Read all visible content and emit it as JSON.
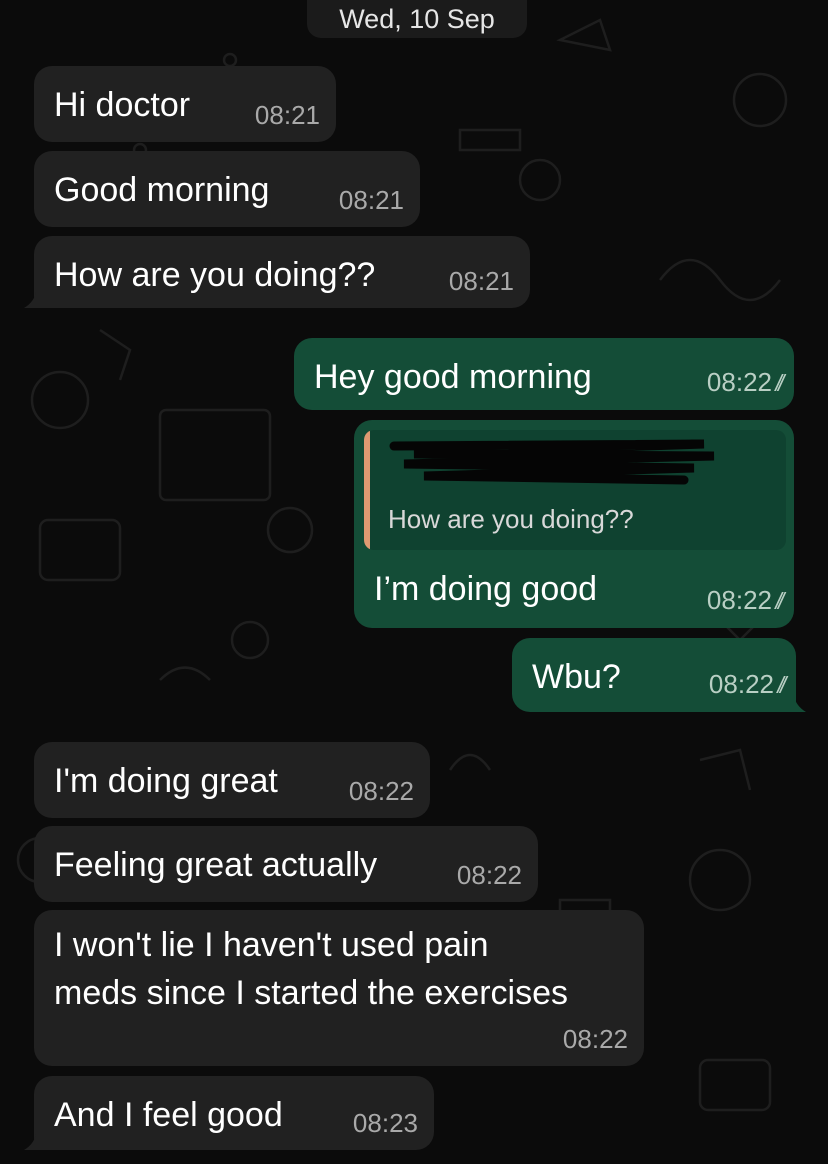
{
  "chat": {
    "date_divider": "Wed, 10 Sep",
    "messages": [
      {
        "direction": "incoming",
        "text": "Hi doctor",
        "time": "08:21"
      },
      {
        "direction": "incoming",
        "text": "Good morning",
        "time": "08:21"
      },
      {
        "direction": "incoming",
        "text": "How are you doing??",
        "time": "08:21"
      },
      {
        "direction": "outgoing",
        "text": "Hey good morning",
        "time": "08:22",
        "status": "read"
      },
      {
        "direction": "outgoing",
        "text": "I’m doing good",
        "time": "08:22",
        "status": "read",
        "quoted_reply": {
          "sender_redacted": true,
          "text": "How are you doing??"
        }
      },
      {
        "direction": "outgoing",
        "text": "Wbu?",
        "time": "08:22",
        "status": "read"
      },
      {
        "direction": "incoming",
        "text": "I'm doing great",
        "time": "08:22"
      },
      {
        "direction": "incoming",
        "text": "Feeling great actually",
        "time": "08:22"
      },
      {
        "direction": "incoming",
        "text_line1": "I won't lie I haven't used pain",
        "text_line2": "meds since I started the exercises",
        "time": "08:22"
      },
      {
        "direction": "incoming",
        "text": "And I feel good",
        "time": "08:23"
      }
    ]
  },
  "colors": {
    "background": "#0b0b0b",
    "incoming_bubble": "#212121",
    "outgoing_bubble": "#144d37",
    "quote_accent": "#e09a72"
  },
  "icons": {
    "read_receipt": "double-check-icon"
  }
}
